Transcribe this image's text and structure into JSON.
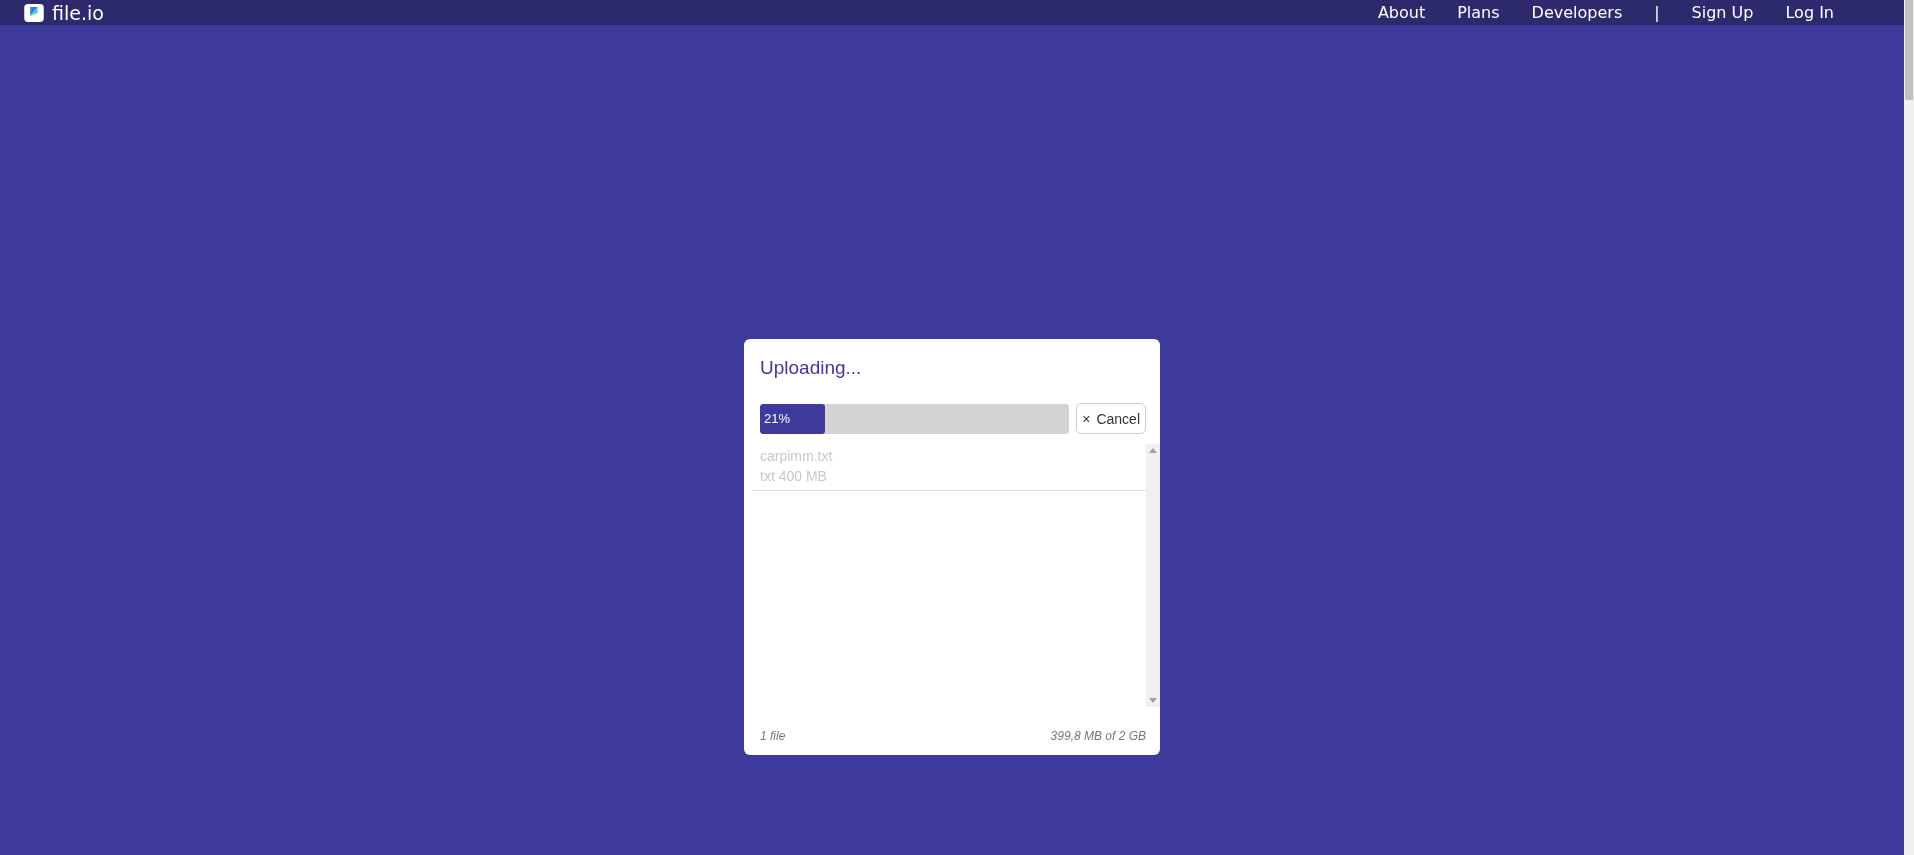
{
  "header": {
    "logo": "file.io",
    "nav": [
      "About",
      "Plans",
      "Developers",
      "|",
      "Sign Up",
      "Log In"
    ]
  },
  "dialog": {
    "title": "Uploading...",
    "progress": {
      "level": 0.21,
      "label": "21%"
    },
    "cancel_button": {
      "icon": "×",
      "label": "Cancel"
    },
    "files": [
      {
        "name": "carpimm.txt",
        "details": "txt 400 MB"
      }
    ],
    "footer": {
      "count": "1 file",
      "usage": "399,8 MB of 2 GB"
    }
  }
}
